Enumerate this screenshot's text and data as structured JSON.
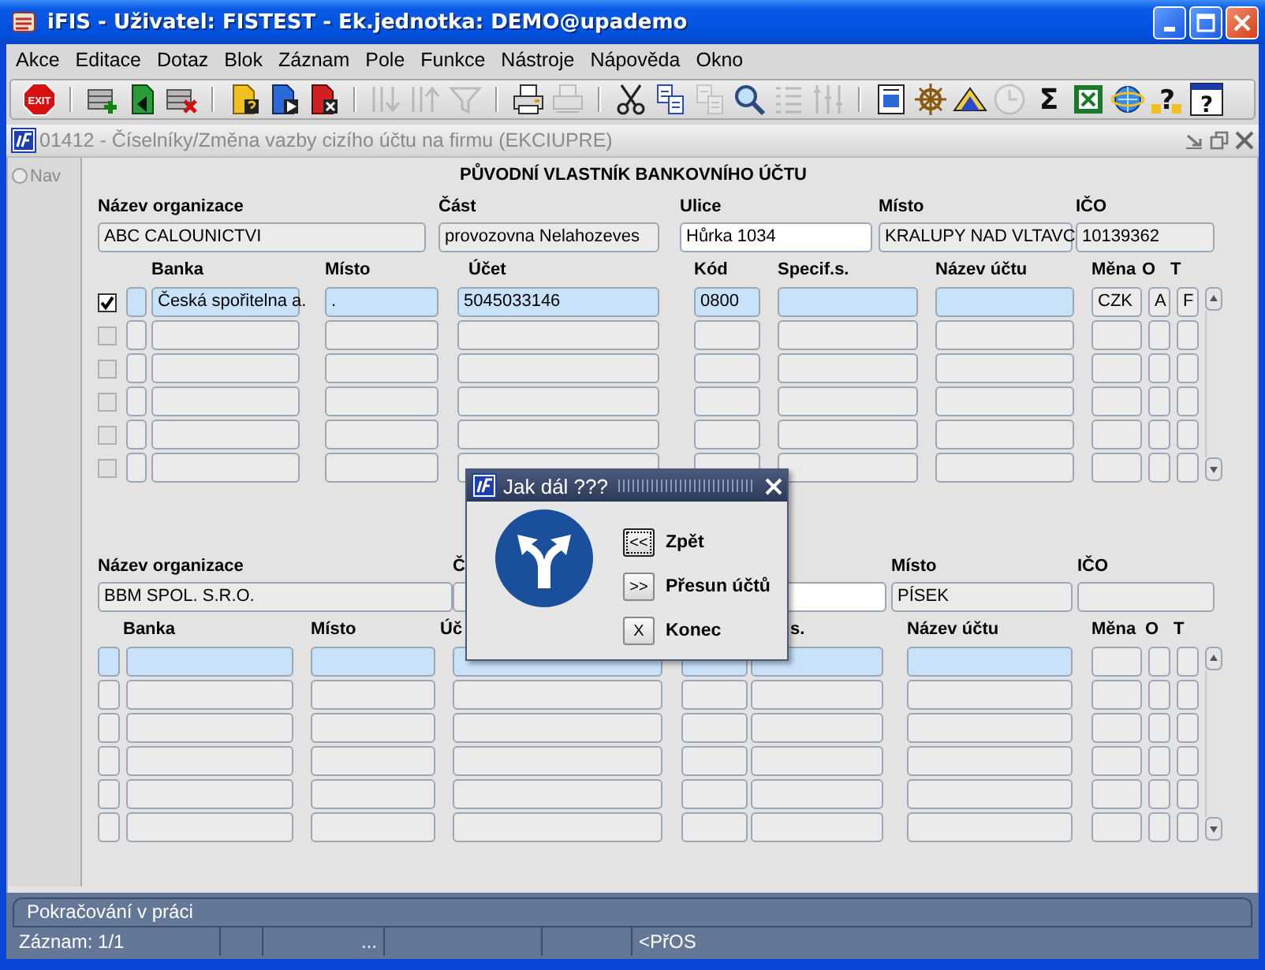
{
  "window": {
    "title": "iFIS - Uživatel: FISTEST - Ek.jednotka: DEMO@upademo"
  },
  "menu": [
    "Akce",
    "Editace",
    "Dotaz",
    "Blok",
    "Záznam",
    "Pole",
    "Funkce",
    "Nástroje",
    "Nápověda",
    "Okno"
  ],
  "toolbar": [
    {
      "kind": "exit",
      "label": "EXIT",
      "disabled": false
    },
    {
      "kind": "separator"
    },
    {
      "kind": "insert",
      "disabled": false
    },
    {
      "kind": "accept",
      "disabled": false
    },
    {
      "kind": "delete",
      "disabled": false
    },
    {
      "kind": "separator"
    },
    {
      "kind": "query",
      "disabled": false
    },
    {
      "kind": "execute",
      "disabled": false
    },
    {
      "kind": "cancel",
      "disabled": false
    },
    {
      "kind": "separator"
    },
    {
      "kind": "sort-asc",
      "disabled": true
    },
    {
      "kind": "sort-desc",
      "disabled": true
    },
    {
      "kind": "filter",
      "disabled": true
    },
    {
      "kind": "separator"
    },
    {
      "kind": "print",
      "disabled": false
    },
    {
      "kind": "print-setup",
      "disabled": true
    },
    {
      "kind": "separator"
    },
    {
      "kind": "cut",
      "disabled": false
    },
    {
      "kind": "copy",
      "disabled": false
    },
    {
      "kind": "paste",
      "disabled": true
    },
    {
      "kind": "find",
      "disabled": false
    },
    {
      "kind": "list",
      "disabled": true
    },
    {
      "kind": "columns",
      "disabled": true
    },
    {
      "kind": "separator"
    },
    {
      "kind": "import",
      "disabled": false
    },
    {
      "kind": "wheel",
      "disabled": false
    },
    {
      "kind": "mountain",
      "disabled": false
    },
    {
      "kind": "clock",
      "disabled": true
    },
    {
      "kind": "sum",
      "label": "Σ",
      "disabled": false
    },
    {
      "kind": "excel",
      "disabled": false
    },
    {
      "kind": "browser",
      "disabled": false
    },
    {
      "kind": "help",
      "label": "?",
      "disabled": false
    },
    {
      "kind": "help-box",
      "label": "?",
      "disabled": false
    }
  ],
  "form": {
    "title": "01412 - Číselníky/Změna vazby cizího účtu na firmu (EKCIUPRE)",
    "nav": {
      "label": "Nav",
      "selected": false
    },
    "sections": [
      {
        "heading": "PŮVODNÍ VLASTNÍK BANKOVNÍHO ÚČTU",
        "fields": [
          {
            "label": "Název organizace",
            "value": "ABC CALOUNICTVI",
            "editable": false
          },
          {
            "label": "Část",
            "value": "provozovna Nelahozeves",
            "editable": false
          },
          {
            "label": "Ulice",
            "value": "Hůrka 1034",
            "editable": true
          },
          {
            "label": "Místo",
            "value": "KRALUPY NAD VLTAVC",
            "editable": false
          },
          {
            "label": "IČO",
            "value": "10139362",
            "editable": false
          }
        ],
        "columns": [
          "Banka",
          "Místo",
          "Účet",
          "Kód",
          "Specif.s.",
          "Název účtu",
          "Měna",
          "O",
          "T"
        ],
        "rows": [
          {
            "checked": true,
            "current": true,
            "cells": {
              "bank": "Česká spořitelna a.",
              "place": ".",
              "account": "5045033146",
              "code": "0800",
              "currency": "CZK",
              "o": "A",
              "t": "F"
            }
          },
          {
            "checked": false,
            "current": false
          },
          {
            "checked": false,
            "current": false
          },
          {
            "checked": false,
            "current": false
          },
          {
            "checked": false,
            "current": false
          },
          {
            "checked": false,
            "current": false
          }
        ]
      },
      {
        "fields": [
          {
            "label": "Název organizace",
            "value": "BBM SPOL. S.R.O.",
            "editable": false
          },
          {
            "label": "Č",
            "editable": false
          },
          {
            "editable": true
          },
          {
            "label": "Místo",
            "value": "PÍSEK",
            "editable": false
          },
          {
            "label": "IČO",
            "editable": false
          }
        ],
        "columns": [
          "Banka",
          "Místo",
          "Úč",
          "s.",
          "Název účtu",
          "Měna",
          "O",
          "T"
        ],
        "rows": [
          {
            "current": true
          },
          {
            "current": false
          },
          {
            "current": false
          },
          {
            "current": false
          },
          {
            "current": false
          },
          {
            "current": false
          }
        ]
      }
    ]
  },
  "dialog": {
    "title": "Jak dál ???",
    "buttons": [
      {
        "key": "<<",
        "label": "Zpět",
        "focused": true
      },
      {
        "key": ">>",
        "label": "Přesun účtů",
        "focused": false
      },
      {
        "key": "X",
        "label": "Konec",
        "focused": false
      }
    ]
  },
  "status": {
    "message": "Pokračování v práci",
    "record": "Záznam: 1/1",
    "cell_3": "...",
    "cell_6": "<PřOS"
  }
}
